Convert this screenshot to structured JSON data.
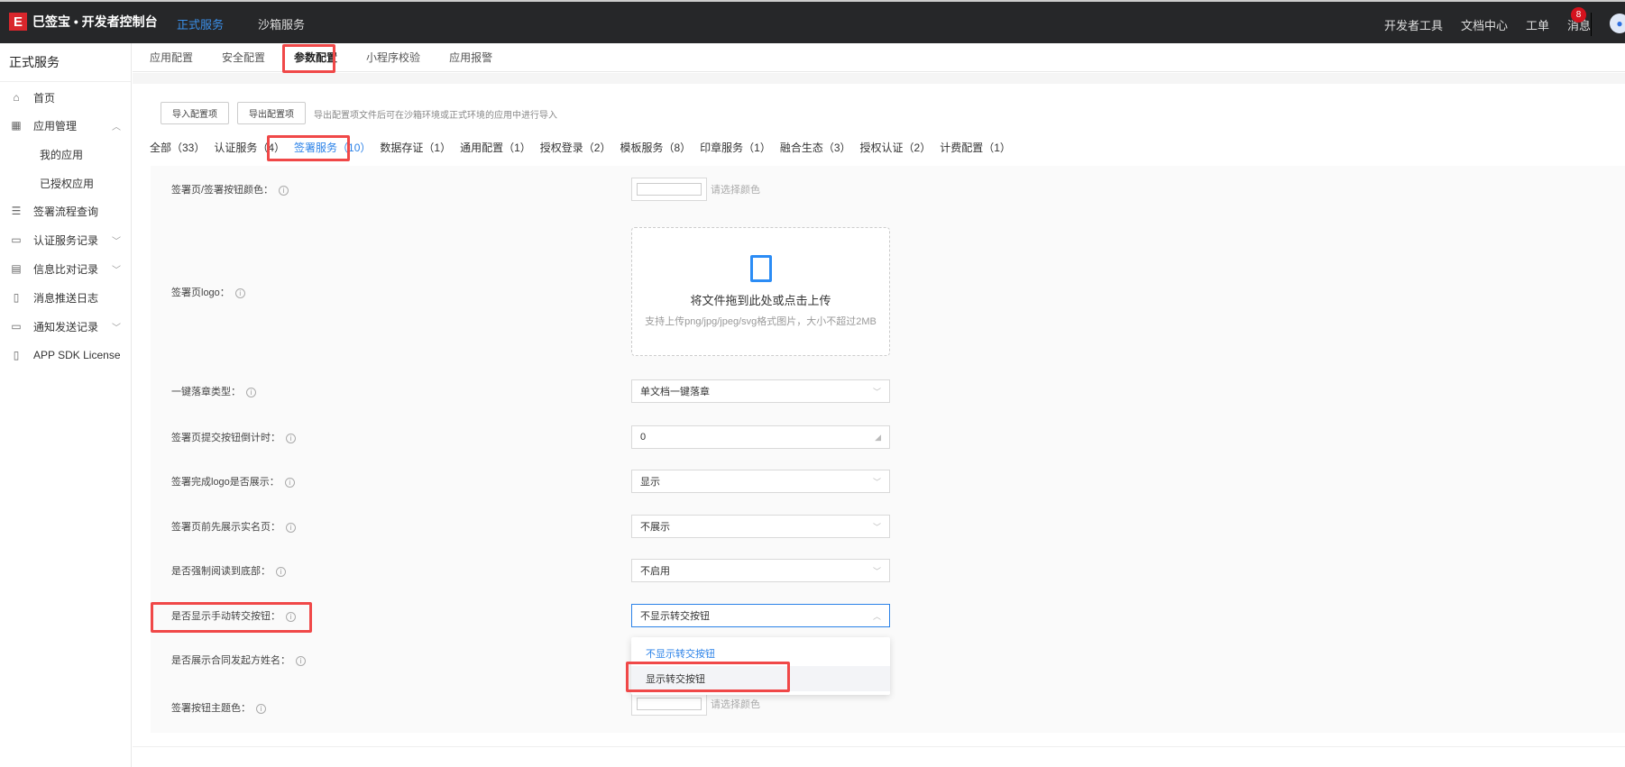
{
  "header": {
    "brand": "巳签宝 • 开发者控制台",
    "logo_mark": "E",
    "nav": [
      "正式服务",
      "沙箱服务"
    ],
    "active_nav": "正式服务",
    "right": [
      "开发者工具",
      "文档中心",
      "工单",
      "消息"
    ],
    "message_badge": "8",
    "accent": "#3b8fe8"
  },
  "sidebar": {
    "title": "正式服务",
    "items": [
      {
        "label": "首页",
        "icon": "home-icon"
      },
      {
        "label": "应用管理",
        "icon": "apps-icon",
        "chevron": "up"
      },
      {
        "label": "我的应用",
        "sub": true
      },
      {
        "label": "已授权应用",
        "sub": true
      },
      {
        "label": "签署流程查询",
        "icon": "search-flow-icon"
      },
      {
        "label": "认证服务记录",
        "icon": "id-card-icon",
        "chevron": "down"
      },
      {
        "label": "信息比对记录",
        "icon": "doc-compare-icon",
        "chevron": "down"
      },
      {
        "label": "消息推送日志",
        "icon": "log-icon"
      },
      {
        "label": "通知发送记录",
        "icon": "message-icon",
        "chevron": "down"
      },
      {
        "label": "APP SDK License",
        "icon": "phone-icon"
      }
    ]
  },
  "subtabs": {
    "items": [
      "应用配置",
      "安全配置",
      "参数配置",
      "小程序校验",
      "应用报警"
    ],
    "active": "参数配置"
  },
  "toolbar": {
    "import": "导入配置项",
    "export": "导出配置项",
    "hint": "导出配置项文件后可在沙箱环境或正式环境的应用中进行导入"
  },
  "filters": {
    "items": [
      "全部（33）",
      "认证服务（4）",
      "签署服务（10）",
      "数据存证（1）",
      "通用配置（1）",
      "授权登录（2）",
      "模板服务（8）",
      "印章服务（1）",
      "融合生态（3）",
      "授权认证（2）",
      "计费配置（1）"
    ],
    "active": "签署服务（10）"
  },
  "form": {
    "sign_btn_color": {
      "label": "签署页/签署按钮颜色：",
      "placeholder": "请选择颜色"
    },
    "logo": {
      "label": "签署页logo：",
      "upload_title": "将文件拖到此处或点击上传",
      "upload_hint": "支持上传png/jpg/jpeg/svg格式图片，大小不超过2MB"
    },
    "seal_type": {
      "label": "一键落章类型：",
      "value": "单文档一键落章"
    },
    "countdown": {
      "label": "签署页提交按钮倒计时：",
      "value": "0"
    },
    "show_logo": {
      "label": "签署完成logo是否展示：",
      "value": "显示"
    },
    "realname": {
      "label": "签署页前先展示实名页：",
      "value": "不展示"
    },
    "force_read": {
      "label": "是否强制阅读到底部：",
      "value": "不启用"
    },
    "transfer": {
      "label": "是否显示手动转交按钮：",
      "value": "不显示转交按钮",
      "options": [
        "不显示转交按钮",
        "显示转交按钮"
      ]
    },
    "initiator": {
      "label": "是否展示合同发起方姓名："
    },
    "theme": {
      "label": "签署按钮主题色：",
      "placeholder": "请选择颜色"
    }
  },
  "highlight_color": "#f04848"
}
